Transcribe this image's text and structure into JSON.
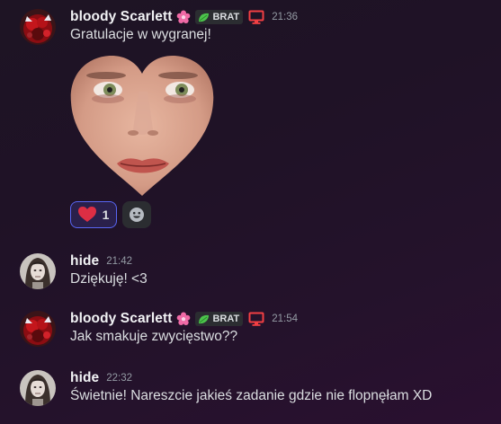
{
  "messages": [
    {
      "username": "bloody Scarlett",
      "badge_label": "BRAT",
      "timestamp": "21:36",
      "text": "Gratulacje w wygranej!",
      "avatar_icon": "bloody-scarlett-avatar",
      "reactions": [
        {
          "emoji": "heart",
          "count": "1"
        }
      ]
    },
    {
      "username": "hide",
      "timestamp": "21:42",
      "text": "Dziękuję! <3",
      "avatar_icon": "hide-avatar"
    },
    {
      "username": "bloody Scarlett",
      "badge_label": "BRAT",
      "timestamp": "21:54",
      "text": "Jak smakuje zwycięstwo??",
      "avatar_icon": "bloody-scarlett-avatar"
    },
    {
      "username": "hide",
      "timestamp": "22:32",
      "text": "Świetnie! Nareszcie jakieś zadanie gdzie nie flopnęłam XD",
      "avatar_icon": "hide-avatar"
    }
  ],
  "colors": {
    "username": "#f2f3f5",
    "text": "#dbdee1",
    "timestamp": "#949ba4",
    "badge_bg": "#2b2d31",
    "leaf_green": "#4cc44c",
    "monitor_red": "#f23f43",
    "reaction_border": "#5865f2",
    "heart_red": "#dd2e44"
  }
}
